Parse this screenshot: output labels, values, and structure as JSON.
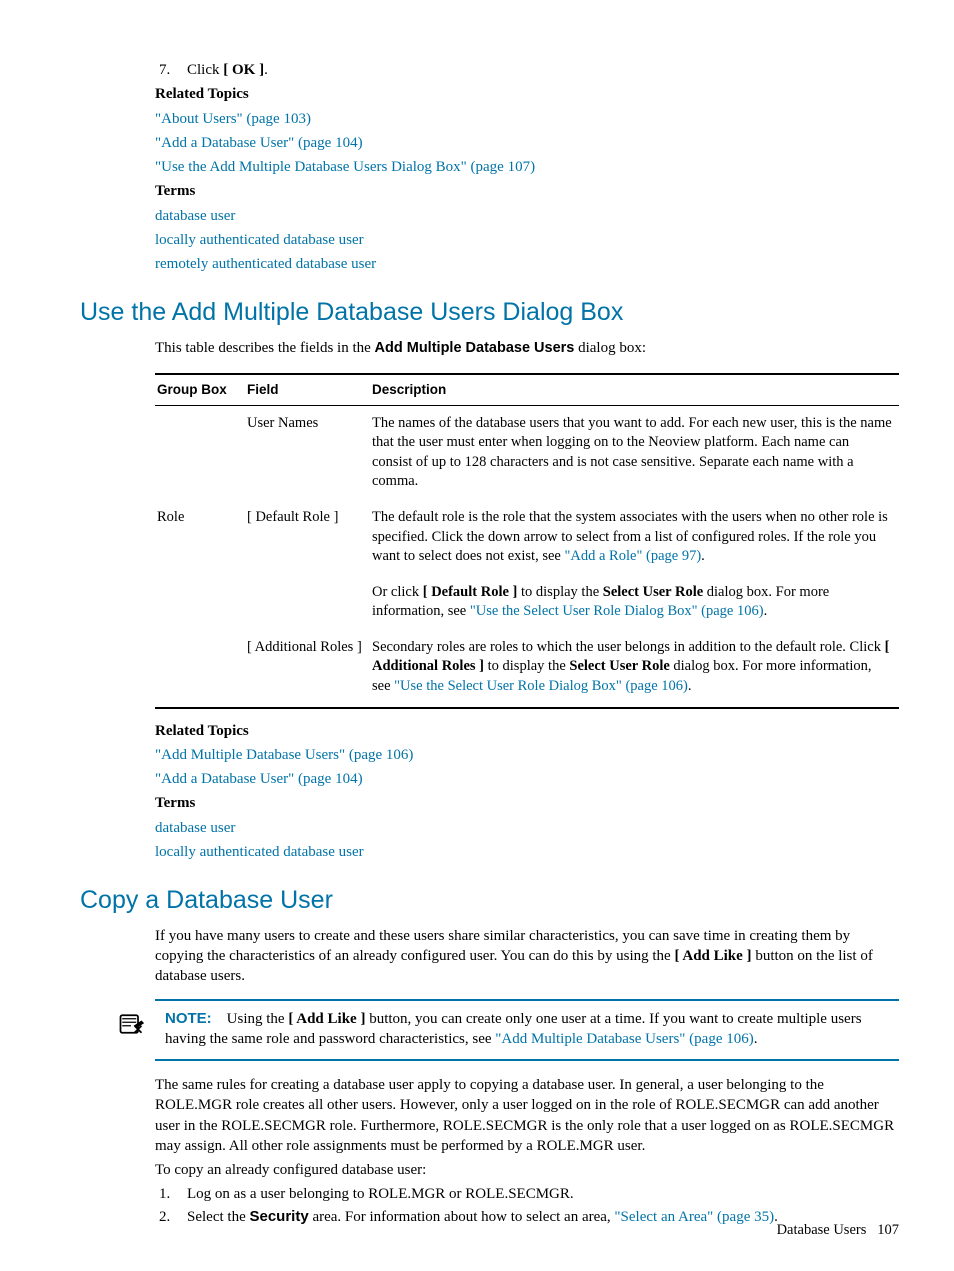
{
  "step7": {
    "num": "7.",
    "pre": "Click ",
    "bold": "[ OK ]",
    "post": "."
  },
  "rel1": {
    "heading": "Related Topics",
    "links": [
      "\"About Users\" (page 103)",
      "\"Add a Database User\" (page 104)",
      "\"Use the Add Multiple Database Users Dialog Box\" (page 107)"
    ]
  },
  "terms1": {
    "heading": "Terms",
    "items": [
      "database user",
      "locally authenticated database user",
      "remotely authenticated database user"
    ]
  },
  "section1": {
    "title": "Use the Add Multiple Database Users Dialog Box",
    "intro_pre": "This table describes the fields in the ",
    "intro_bold": "Add Multiple Database Users",
    "intro_post": " dialog box:",
    "headers": {
      "gb": "Group Box",
      "fld": "Field",
      "desc": "Description"
    },
    "rows": [
      {
        "gb": "",
        "fld": "User Names",
        "desc": {
          "parts": [
            {
              "t": "The names of the database users that you want to add. For each new user, this is the name that the user must enter when logging on to the Neoview platform. Each name can consist of up to 128 characters and is not case sensitive. Separate each name with a comma."
            }
          ]
        }
      },
      {
        "gb": "Role",
        "fld": "[ Default Role ]",
        "desc": {
          "parts": [
            {
              "t": "The default role is the role that the system associates with the users when no other role is specified. Click the down arrow to select from a list of configured roles. If the role you want to select does not exist, see "
            },
            {
              "t": "\"Add a Role\" (page 97)",
              "link": true
            },
            {
              "t": "."
            }
          ]
        }
      },
      {
        "gb": "",
        "fld": "",
        "desc": {
          "parts": [
            {
              "t": "Or click "
            },
            {
              "t": "[ Default Role ]",
              "bold": true
            },
            {
              "t": " to display the "
            },
            {
              "t": "Select User Role",
              "bold": true
            },
            {
              "t": " dialog box. For more information, see "
            },
            {
              "t": "\"Use the Select User Role Dialog Box\" (page 106)",
              "link": true
            },
            {
              "t": "."
            }
          ]
        }
      },
      {
        "gb": "",
        "fld": "[ Additional Roles ]",
        "desc": {
          "parts": [
            {
              "t": "Secondary roles are roles to which the user belongs in addition to the default role. Click "
            },
            {
              "t": "[ Additional Roles ]",
              "bold": true
            },
            {
              "t": " to display the "
            },
            {
              "t": "Select User Role",
              "bold": true
            },
            {
              "t": " dialog box. For more information, see "
            },
            {
              "t": "\"Use the Select User Role Dialog Box\" (page 106)",
              "link": true
            },
            {
              "t": "."
            }
          ]
        }
      }
    ]
  },
  "rel2": {
    "heading": "Related Topics",
    "links": [
      "\"Add Multiple Database Users\" (page 106)",
      "\"Add a Database User\" (page 104)"
    ]
  },
  "terms2": {
    "heading": "Terms",
    "items": [
      "database user",
      "locally authenticated database user"
    ]
  },
  "section2": {
    "title": "Copy a Database User",
    "p1": {
      "parts": [
        {
          "t": "If you have many users to create and these users share similar characteristics, you can save time in creating them by copying the characteristics of an already configured user. You can do this by using the "
        },
        {
          "t": "[ Add Like ]",
          "bold": true
        },
        {
          "t": " button on the list of database users."
        }
      ]
    },
    "note": {
      "label": "NOTE:",
      "parts": [
        {
          "t": "Using the "
        },
        {
          "t": "[ Add Like ]",
          "bold": true
        },
        {
          "t": " button, you can create only one user at a time. If you want to create multiple users having the same role and password characteristics, see "
        },
        {
          "t": "\"Add Multiple Database Users\" (page 106)",
          "link": true
        },
        {
          "t": "."
        }
      ]
    },
    "p2": "The same rules for creating a database user apply to copying a database user. In general, a user belonging to the ROLE.MGR role creates all other users. However, only a user logged on in the role of ROLE.SECMGR can add another user in the ROLE.SECMGR role. Furthermore, ROLE.SECMGR is the only role that a user logged on as ROLE.SECMGR may assign. All other role assignments must be performed by a ROLE.MGR user.",
    "p3": "To copy an already configured database user:",
    "steps": [
      {
        "num": "1.",
        "parts": [
          {
            "t": "Log on as a user belonging to ROLE.MGR or ROLE.SECMGR."
          }
        ]
      },
      {
        "num": "2.",
        "parts": [
          {
            "t": "Select the "
          },
          {
            "t": "Security",
            "bold": true,
            "sans": true
          },
          {
            "t": " area. For information about how to select an area, "
          },
          {
            "t": "\"Select an Area\" (page 35)",
            "link": true
          },
          {
            "t": "."
          }
        ]
      }
    ]
  },
  "footer": {
    "section": "Database Users",
    "page": "107"
  }
}
